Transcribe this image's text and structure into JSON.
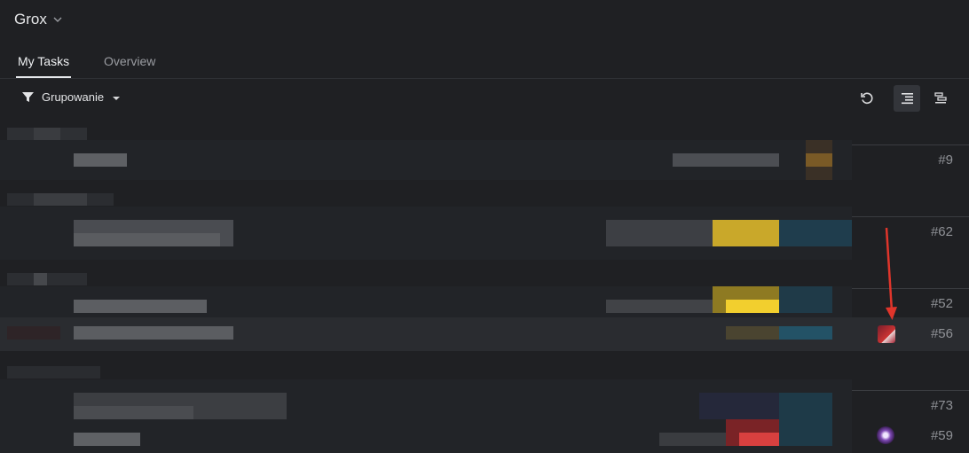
{
  "app": {
    "title": "Grox"
  },
  "tabs": [
    {
      "label": "My Tasks",
      "active": true
    },
    {
      "label": "Overview",
      "active": false
    }
  ],
  "toolbar": {
    "grouping_label": "Grupowanie",
    "icons": [
      "refresh-icon",
      "align-right-icon",
      "timeline-icon"
    ]
  },
  "tasks": [
    {
      "number": "#9"
    },
    {
      "number": "#62"
    },
    {
      "number": "#52"
    },
    {
      "number": "#56"
    },
    {
      "number": "#73"
    },
    {
      "number": "#59"
    }
  ],
  "colors": {
    "background": "#1f2023",
    "highlight_row": "#2a2c30",
    "arrow": "#e0352b",
    "yellow_tag": "#e2bf2c",
    "red_tag": "#c8373a",
    "teal_tag": "#1f4a5e"
  }
}
